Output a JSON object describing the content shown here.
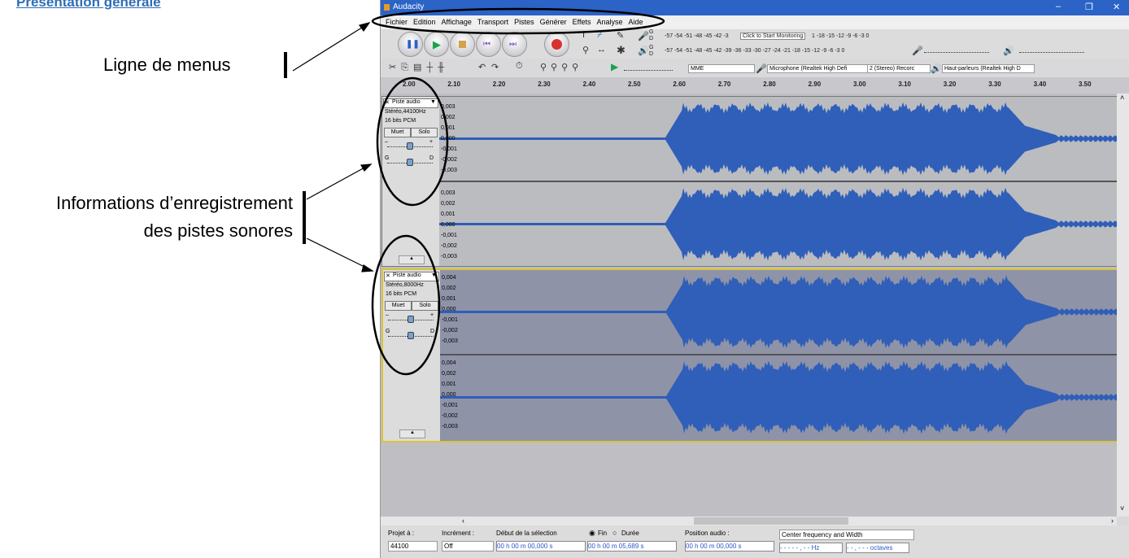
{
  "doc": {
    "title": "Présentation générale",
    "anno_menu": "Ligne de menus",
    "anno_tracks_1": "Informations d’enregistrement",
    "anno_tracks_2": "des pistes sonores"
  },
  "window": {
    "title": "Audacity",
    "minimize": "–",
    "restore": "❐",
    "close": "✕"
  },
  "menu": [
    "Fichier",
    "Edition",
    "Affichage",
    "Transport",
    "Pistes",
    "Générer",
    "Effets",
    "Analyse",
    "Aide"
  ],
  "meters": {
    "rec_scale": "-57 -54 -51 -48 -45 -42 -3",
    "rec_monitor": "Click to Start Monitoring",
    "rec_scale_end": "1 -18 -15 -12 -9 -6 -3 0",
    "play_scale": "-57 -54 -51 -48 -45 -42 -39 -36 -33 -30 -27 -24 -21 -18 -15 -12 -9 -6 -3 0",
    "lr_top": "G",
    "lr_bottom": "D"
  },
  "devices": {
    "host": "MME",
    "mic": "Microphone (Realtek High Defi",
    "channels": "2 (Stereo) Recorc",
    "speakers": "Haut-parleurs (Realtek High D"
  },
  "ruler": [
    "2.00",
    "2.10",
    "2.20",
    "2.30",
    "2.40",
    "2.50",
    "2.60",
    "2.70",
    "2.80",
    "2.90",
    "3.00",
    "3.10",
    "3.20",
    "3.30",
    "3.40",
    "3.50"
  ],
  "tracks": [
    {
      "name": "Piste audio",
      "rate": "Stéréo,44100Hz",
      "format": "16 bits PCM",
      "mute": "Muet",
      "solo": "Solo",
      "gain_minus": "–",
      "gain_plus": "+",
      "pan_l": "G",
      "pan_r": "D",
      "scale_top": [
        "0,003",
        "0,002",
        "0,001",
        "0,000",
        "-0,001",
        "-0,002",
        "-0,003"
      ],
      "scale_bottom": [
        "0,003",
        "0,002",
        "0,001",
        "0,000",
        "-0,001",
        "-0,002",
        "-0,003"
      ]
    },
    {
      "name": "Piste audio",
      "rate": "Stéréo,8000Hz",
      "format": "16 bits PCM",
      "mute": "Muet",
      "solo": "Solo",
      "gain_minus": "–",
      "gain_plus": "+",
      "pan_l": "G",
      "pan_r": "D",
      "scale_top": [
        "0,004",
        "0,002",
        "0,001",
        "0,000",
        "-0,001",
        "-0,002",
        "-0,003"
      ],
      "scale_bottom": [
        "0,004",
        "0,002",
        "0,001",
        "0,000",
        "-0,001",
        "-0,002",
        "-0,003"
      ]
    }
  ],
  "selection": {
    "project_label": "Projet à :",
    "project_value": "44100",
    "snap_label": "Incrément :",
    "snap_value": "Off",
    "start_label": "Début de la sélection",
    "end_label": "Fin",
    "length_label": "Durée",
    "start_time": "00 h 00 m 00,000 s",
    "end_time": "00 h 00 m 05,689 s",
    "pos_label": "Position audio :",
    "pos_time": "00 h 00 m 00,000 s",
    "spectral_mode": "Center frequency and Width",
    "freq_field": "- - - - - , - -  Hz",
    "oct_field": "- - , - - -  octaves"
  }
}
